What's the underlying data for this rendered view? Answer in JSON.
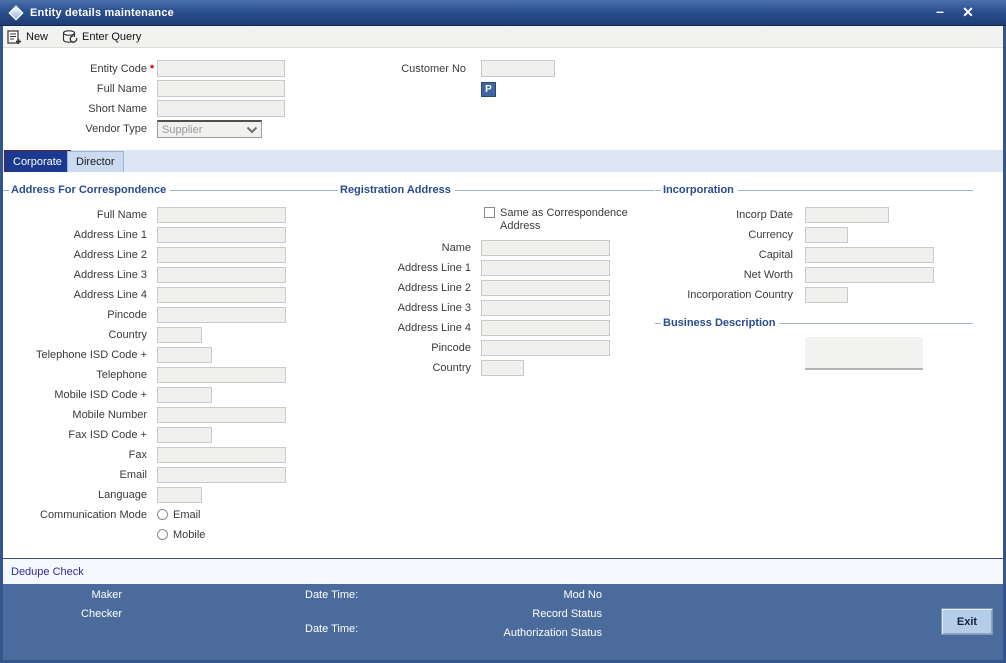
{
  "window": {
    "title": "Entity details maintenance",
    "minimize_glyph": "–",
    "close_glyph": "✕"
  },
  "toolbar": {
    "new_label": "New",
    "enter_query_label": "Enter Query"
  },
  "header_form": {
    "entity_code_label": "Entity Code",
    "entity_code_required": "*",
    "entity_code_value": "",
    "full_name_label": "Full Name",
    "full_name_value": "",
    "short_name_label": "Short Name",
    "short_name_value": "",
    "vendor_type_label": "Vendor Type",
    "vendor_type_value": "Supplier",
    "customer_no_label": "Customer No",
    "customer_no_value": "",
    "p_button_label": "P"
  },
  "tabs": {
    "active": "Corporate",
    "items": [
      {
        "label": "Corporate"
      },
      {
        "label": "Director"
      }
    ]
  },
  "correspondence": {
    "title": "Address For Correspondence",
    "fields": [
      {
        "label": "Full Name",
        "value": ""
      },
      {
        "label": "Address Line 1",
        "value": ""
      },
      {
        "label": "Address Line 2",
        "value": ""
      },
      {
        "label": "Address Line 3",
        "value": ""
      },
      {
        "label": "Address Line 4",
        "value": ""
      },
      {
        "label": "Pincode",
        "value": ""
      },
      {
        "label": "Country",
        "value": ""
      },
      {
        "label": "Telephone ISD Code +",
        "value": ""
      },
      {
        "label": "Telephone",
        "value": ""
      },
      {
        "label": "Mobile ISD Code +",
        "value": ""
      },
      {
        "label": "Mobile Number",
        "value": ""
      },
      {
        "label": "Fax ISD Code +",
        "value": ""
      },
      {
        "label": "Fax",
        "value": ""
      },
      {
        "label": "Email",
        "value": ""
      },
      {
        "label": "Language",
        "value": ""
      }
    ],
    "communication_mode_label": "Communication Mode",
    "communication_options": [
      {
        "label": "Email",
        "checked": false
      },
      {
        "label": "Mobile",
        "checked": false
      }
    ]
  },
  "registration": {
    "title": "Registration Address",
    "same_as_label": "Same as Correspondence Address",
    "same_as_checked": false,
    "fields": [
      {
        "label": "Name",
        "value": ""
      },
      {
        "label": "Address Line 1",
        "value": ""
      },
      {
        "label": "Address Line 2",
        "value": ""
      },
      {
        "label": "Address Line 3",
        "value": ""
      },
      {
        "label": "Address Line 4",
        "value": ""
      },
      {
        "label": "Pincode",
        "value": ""
      },
      {
        "label": "Country",
        "value": ""
      }
    ]
  },
  "incorporation": {
    "title": "Incorporation",
    "fields": [
      {
        "label": "Incorp Date",
        "value": ""
      },
      {
        "label": "Currency",
        "value": ""
      },
      {
        "label": "Capital",
        "value": ""
      },
      {
        "label": "Net Worth",
        "value": ""
      },
      {
        "label": "Incorporation Country",
        "value": ""
      }
    ]
  },
  "business": {
    "title": "Business Description",
    "value": ""
  },
  "dedupe": {
    "label": "Dedupe Check"
  },
  "footer": {
    "maker_label": "Maker",
    "checker_label": "Checker",
    "date_time_label_1": "Date Time:",
    "date_time_label_2": "Date Time:",
    "mod_no_label": "Mod No",
    "record_status_label": "Record Status",
    "authorization_status_label": "Authorization Status",
    "exit_label": "Exit"
  },
  "colors": {
    "titlebar_top": "#4a70ab",
    "titlebar_bottom": "#1d3c72",
    "active_tab": "#1b3a8f",
    "tabbar_bg": "#dce6f5",
    "section_title": "#2b4b8e",
    "footer_bg": "#4a6b9c",
    "dedupe_link": "#2d2da0",
    "required_marker": "#c00000",
    "input_bg": "#f0f0ee"
  }
}
